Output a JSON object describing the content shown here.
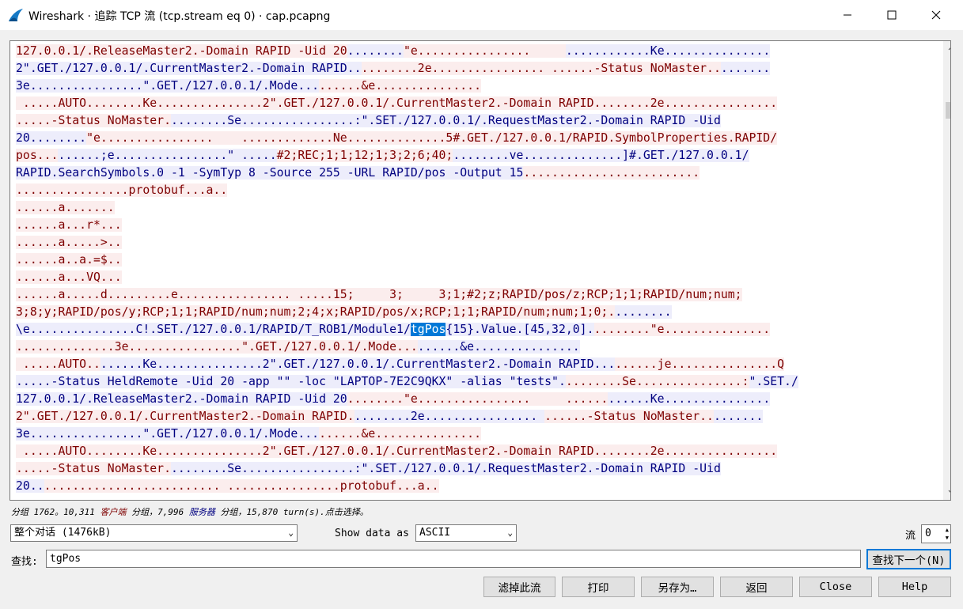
{
  "window": {
    "title": "Wireshark · 追踪 TCP 流 (tcp.stream eq 0) · cap.pcapng"
  },
  "stream_lines": [
    [
      [
        "c",
        "127.0.0.1/.ReleaseMaster2.-Domain RAPID -Uid 20"
      ],
      [
        "s",
        "........"
      ],
      [
        "c",
        "\"e................     "
      ],
      [
        "s",
        "............Ke..............."
      ]
    ],
    [
      [
        "s",
        "2\".GET./127.0.0.1/.CurrentMaster2.-Domain RAPID.."
      ],
      [
        "c",
        "........2e................ ......-Status NoMaster.."
      ],
      [
        "s",
        "......."
      ]
    ],
    [
      [
        "s",
        "3e................\".GET./127.0.0.1/.Mode..."
      ],
      [
        "c",
        "......&e..............."
      ]
    ],
    [
      [
        "c",
        " .....AUTO........Ke...............2\".GET./127.0.0.1/.CurrentMaster2.-Domain RAPID........2e................"
      ]
    ],
    [
      [
        "c",
        ".....-Status NoMaster."
      ],
      [
        "s",
        "........Se................:\".SET./127.0.0.1/.RequestMaster2.-Domain RAPID -Uid"
      ]
    ],
    [
      [
        "s",
        "20........"
      ],
      [
        "c",
        "\"e................    .............Ne..............5#.GET./127.0.0.1/RAPID.SymbolProperties.RAPID/"
      ]
    ],
    [
      [
        "c",
        "pos..."
      ],
      [
        "s",
        "......;e................\" ....."
      ],
      [
        "c",
        "#2;REC;1;1;12;1;3;2;6;40;"
      ],
      [
        "s",
        "........ve..............]#.GET./127.0.0.1/"
      ]
    ],
    [
      [
        "s",
        "RAPID.SearchSymbols.0 -1 -SymTyp 8 -Source 255 -URL RAPID/pos -Output 15"
      ],
      [
        "c",
        "........................."
      ]
    ],
    [
      [
        "c",
        "................protobuf...a.."
      ]
    ],
    [
      [
        "c",
        "......a......."
      ]
    ],
    [
      [
        "c",
        "......a...r*..."
      ]
    ],
    [
      [
        "c",
        "......a.....>.."
      ]
    ],
    [
      [
        "c",
        "......a..a.=$.."
      ]
    ],
    [
      [
        "c",
        "......a...VQ..."
      ]
    ],
    [
      [
        "c",
        "......a.....d.........e................ .....15;     3;     3;1;#2;z;RAPID/pos/z;RCP;1;1;RAPID/num;num;"
      ]
    ],
    [
      [
        "c",
        "3;8;y;RAPID/pos/y;RCP;1;1;RAPID/num;num;2;4;x;RAPID/pos/x;RCP;1;1;RAPID/num;num;1;0;."
      ],
      [
        "s",
        "........"
      ]
    ],
    [
      [
        "s",
        "\\e...............C!.SET./127.0.0.1/RAPID/T_ROB1/Module1/"
      ],
      [
        "h",
        "tgPos"
      ],
      [
        "s",
        "{15}.Value.[45,32,0]."
      ],
      [
        "c",
        "........\"e..............."
      ]
    ],
    [
      [
        "c",
        "..............3e................\".GET./127.0.0.1/.Mode..."
      ],
      [
        "s",
        "......&e..............."
      ]
    ],
    [
      [
        "c",
        " .....AUTO.."
      ],
      [
        "s",
        "......Ke...............2\".GET./127.0.0.1/.CurrentMaster2.-Domain RAPID..."
      ],
      [
        "c",
        "......je...............Q"
      ]
    ],
    [
      [
        "s",
        ".....-Status HeldRemote -Uid 20 -app \"\" -loc \"LAPTOP-7E2C9QKX\" -alias \"tests\"."
      ],
      [
        "c",
        "........Se...............:"
      ],
      [
        "s",
        "\".SET./"
      ]
    ],
    [
      [
        "s",
        "127.0.0.1/.ReleaseMaster2.-Domain RAPID -Uid 20"
      ],
      [
        "c",
        "........\"e................     ......"
      ],
      [
        "s",
        "......Ke..............."
      ]
    ],
    [
      [
        "c",
        "2\".GET./127.0.0.1/.CurrentMaster2.-Domain RAPID."
      ],
      [
        "s",
        "........2e................ "
      ],
      [
        "c",
        "......-Status NoMaster.."
      ],
      [
        "s",
        "......."
      ]
    ],
    [
      [
        "s",
        "3e................\".GET./127.0.0.1/.Mode..."
      ],
      [
        "c",
        "......&e..............."
      ]
    ],
    [
      [
        "c",
        " .....AUTO........Ke...............2\".GET./127.0.0.1/.CurrentMaster2.-Domain RAPID........2e................"
      ]
    ],
    [
      [
        "c",
        ".....-Status NoMaster."
      ],
      [
        "s",
        "........Se................:\".SET./127.0.0.1/.RequestMaster2.-Domain RAPID -Uid"
      ]
    ],
    [
      [
        "s",
        "20.."
      ],
      [
        "c",
        "......................... ................protobuf...a.."
      ]
    ]
  ],
  "status": {
    "prefix": "分组 1762。10,311 ",
    "client": "客户端",
    "mid": " 分组，7,996 ",
    "server": "服务器",
    "suffix": " 分组，15,870 turn(s).点击选择。"
  },
  "controls": {
    "conversation": "整个对话 (1476kB)",
    "show_data_label": "Show data as",
    "show_data_value": "ASCII",
    "stream_label": "流",
    "stream_value": "0",
    "find_label": "查找:",
    "find_value": "tgPos",
    "find_next": "查找下一个(N)"
  },
  "buttons": {
    "filter_out": "滤掉此流",
    "print": "打印",
    "save_as": "另存为…",
    "back": "返回",
    "close": "Close",
    "help": "Help"
  }
}
